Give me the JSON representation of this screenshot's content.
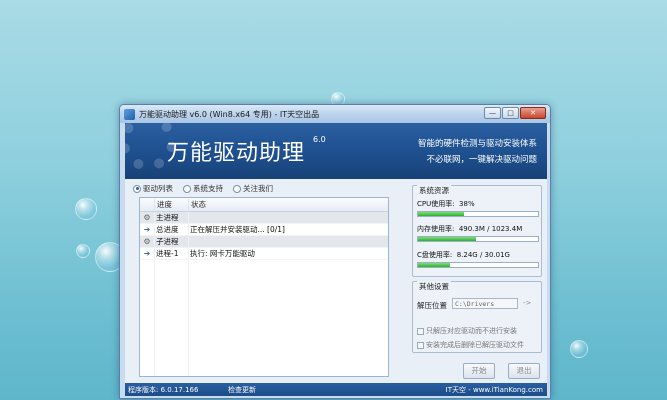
{
  "window": {
    "title": "万能驱动助理 v6.0 (Win8.x64 专用) - IT天空出品",
    "buttons": {
      "minimize": "—",
      "maximize": "□",
      "close": "✕"
    }
  },
  "banner": {
    "title": "万能驱动助理",
    "version": "6.0",
    "slogan_line1": "智能的硬件检测与驱动安装体系",
    "slogan_line2": "不必联网，一键解决驱动问题"
  },
  "tabs": [
    {
      "label": "驱动列表",
      "selected": true
    },
    {
      "label": "系统支持",
      "selected": false
    },
    {
      "label": "关注我们",
      "selected": false
    }
  ],
  "task_list": {
    "headers": {
      "progress": "进度",
      "status": "状态"
    },
    "rows": [
      {
        "icon": "gear-icon",
        "progress": "主进程",
        "status": ""
      },
      {
        "icon": "arrow-icon",
        "progress": "总进度",
        "status": "正在解压并安装驱动... [0/1]"
      },
      {
        "icon": "gear-icon",
        "progress": "子进程",
        "status": ""
      },
      {
        "icon": "arrow-icon",
        "progress": "进程-1",
        "status": "执行: 网卡万能驱动"
      }
    ]
  },
  "system_resources": {
    "title": "系统资源",
    "cpu": {
      "label": "CPU使用率:",
      "value": "38%",
      "percent": 38
    },
    "memory": {
      "label": "内存使用率:",
      "value": "490.3M / 1023.4M",
      "percent": 48
    },
    "disk": {
      "label": "C盘使用率:",
      "value": "8.24G / 30.01G",
      "percent": 27
    }
  },
  "other_settings": {
    "title": "其他设置",
    "extract_label": "解压位置",
    "extract_path": "C:\\Drivers",
    "browse": "->",
    "option1": "只解压对应驱动而不进行安装",
    "option2": "安装完成后删除已解压驱动文件"
  },
  "actions": {
    "start": "开始",
    "exit": "退出"
  },
  "statusbar": {
    "version": "程序版本: 6.0.17.166",
    "update": "检查更新",
    "brand": "IT天空 - www.iTianKong.com"
  },
  "colors": {
    "banner": "#1e4f8e",
    "progress_fill": "#2fb12a",
    "desktop": "#8fd0de"
  }
}
